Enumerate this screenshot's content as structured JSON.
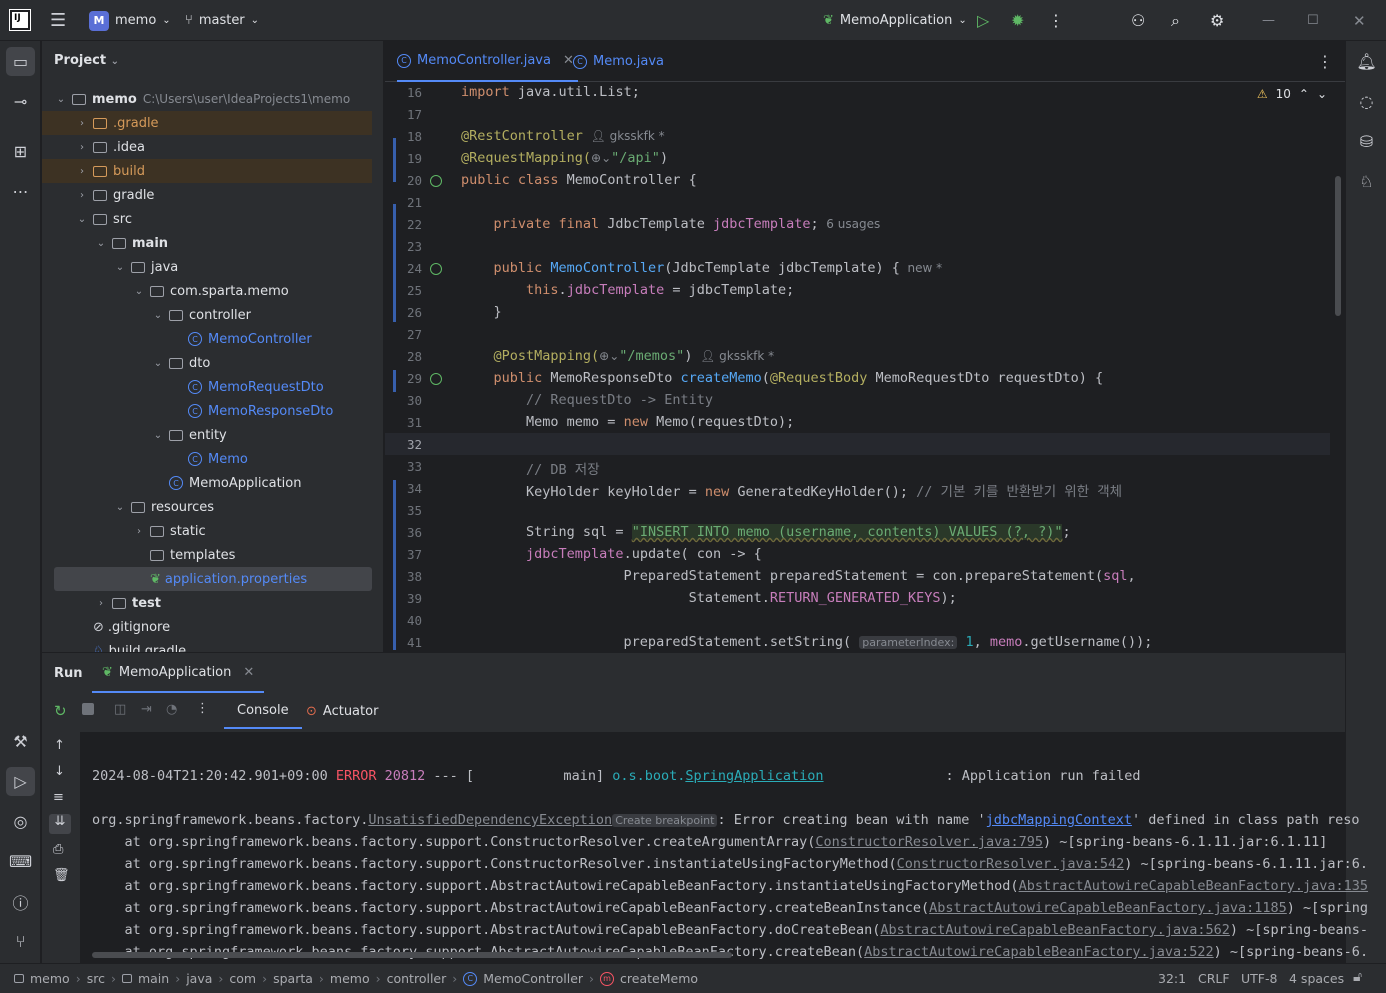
{
  "titlebar": {
    "project_badge": "M",
    "project_name": "memo",
    "branch": "master",
    "run_config": "MemoApplication"
  },
  "project_panel": {
    "title": "Project",
    "root_name": "memo",
    "root_path": "C:\\Users\\user\\IdeaProjects1\\memo",
    "items": [
      {
        "label": ".gradle",
        "kind": "folder-orange"
      },
      {
        "label": ".idea",
        "kind": "folder"
      },
      {
        "label": "build",
        "kind": "folder-orange"
      },
      {
        "label": "gradle",
        "kind": "folder"
      },
      {
        "label": "src",
        "kind": "folder"
      },
      {
        "label": "main",
        "kind": "folder"
      },
      {
        "label": "java",
        "kind": "folder"
      },
      {
        "label": "com.sparta.memo",
        "kind": "package"
      },
      {
        "label": "controller",
        "kind": "package"
      },
      {
        "label": "MemoController",
        "kind": "class"
      },
      {
        "label": "dto",
        "kind": "package"
      },
      {
        "label": "MemoRequestDto",
        "kind": "class"
      },
      {
        "label": "MemoResponseDto",
        "kind": "class"
      },
      {
        "label": "entity",
        "kind": "package"
      },
      {
        "label": "Memo",
        "kind": "class"
      },
      {
        "label": "MemoApplication",
        "kind": "app-class"
      },
      {
        "label": "resources",
        "kind": "folder"
      },
      {
        "label": "static",
        "kind": "folder"
      },
      {
        "label": "templates",
        "kind": "folder"
      },
      {
        "label": "application.properties",
        "kind": "properties"
      },
      {
        "label": "test",
        "kind": "folder"
      },
      {
        "label": ".gitignore",
        "kind": "ignore"
      },
      {
        "label": "build.gradle",
        "kind": "gradle"
      }
    ]
  },
  "editor": {
    "tabs": [
      {
        "label": "MemoController.java"
      },
      {
        "label": "Memo.java"
      }
    ],
    "warning_count": "10",
    "line_numbers": [
      "16",
      "17",
      "18",
      "19",
      "20",
      "21",
      "22",
      "23",
      "24",
      "25",
      "26",
      "27",
      "28",
      "29",
      "30",
      "31",
      "32",
      "33",
      "34",
      "35",
      "36",
      "37",
      "38",
      "39",
      "40",
      "41"
    ],
    "lines": {
      "l16a": "import",
      "l16b": " java.util.List;",
      "l18a": "@RestController",
      "l18author": "gksskfk *",
      "l19a": "@RequestMapping(",
      "l19b": "\"/api\"",
      "l19c": ")",
      "l20a": "public class",
      "l20b": " MemoController {",
      "l22a": "    private final",
      "l22b": " JdbcTemplate ",
      "l22c": "jdbcTemplate",
      "l22d": ";",
      "l22usages": "6 usages",
      "l24a": "    public",
      "l24b": " MemoController",
      "l24c": "(JdbcTemplate jdbcTemplate) {",
      "l24new": "new *",
      "l25a": "        this",
      "l25b": ".",
      "l25c": "jdbcTemplate",
      "l25d": " = jdbcTemplate;",
      "l26": "    }",
      "l28a": "    @PostMapping(",
      "l28b": "\"/memos\"",
      "l28c": ")",
      "l28author": "gksskfk *",
      "l29a": "    public",
      "l29b": " MemoResponseDto ",
      "l29c": "createMemo",
      "l29d": "(",
      "l29e": "@RequestBody",
      "l29f": " MemoRequestDto requestDto) {",
      "l30": "        // RequestDto -> Entity",
      "l31a": "        Memo memo = ",
      "l31b": "new",
      "l31c": " Memo(requestDto);",
      "l33": "        // DB 저장",
      "l34a": "        KeyHolder keyHolder = ",
      "l34b": "new",
      "l34c": " GeneratedKeyHolder(); ",
      "l34d": "// 기본 키를 반환받기 위한 객체",
      "l36a": "        String sql = ",
      "l36b": "\"INSERT INTO memo (username, contents) VALUES (?, ?)\"",
      "l36c": ";",
      "l37a": "        ",
      "l37b": "jdbcTemplate",
      "l37c": ".update( con -> {",
      "l38a": "                    PreparedStatement preparedStatement = con.prepareStatement(",
      "l38b": "sql",
      "l38c": ",",
      "l39a": "                            Statement.",
      "l39b": "RETURN_GENERATED_KEYS",
      "l39c": ");",
      "l41a": "                    preparedStatement.setString( ",
      "l41hint": "parameterIndex:",
      "l41b": " 1",
      "l41c": ", ",
      "l41d": "memo",
      "l41e": ".getUsername());"
    }
  },
  "run_panel": {
    "title": "Run",
    "tab": "MemoApplication",
    "subtabs": [
      "Console",
      "Actuator"
    ],
    "console": {
      "line1_ts": "2024-08-04T21:20:42.901+09:00 ",
      "line1_level": "ERROR",
      "line1_pid": " 20812",
      "line1_mid": " --- [           main] ",
      "line1_logger1": "o.s.boot.",
      "line1_logger2": "SpringApplication",
      "line1_msg": "               : Application run failed",
      "line2_a": "org.springframework.beans.factory.",
      "line2_exc": "UnsatisfiedDependencyException",
      "line2_bp": "Create breakpoint",
      "line2_b": ": Error creating bean with name '",
      "line2_bean": "jdbcMappingContext",
      "line2_c": "' defined in class path reso",
      "stack": [
        {
          "a": "    at org.springframework.beans.factory.support.ConstructorResolver.createArgumentArray(",
          "l": "ConstructorResolver.java:795",
          "b": ") ~[spring-beans-6.1.11.jar:6.1.11]"
        },
        {
          "a": "    at org.springframework.beans.factory.support.ConstructorResolver.instantiateUsingFactoryMethod(",
          "l": "ConstructorResolver.java:542",
          "b": ") ~[spring-beans-6.1.11.jar:6."
        },
        {
          "a": "    at org.springframework.beans.factory.support.AbstractAutowireCapableBeanFactory.instantiateUsingFactoryMethod(",
          "l": "AbstractAutowireCapableBeanFactory.java:135",
          "b": ""
        },
        {
          "a": "    at org.springframework.beans.factory.support.AbstractAutowireCapableBeanFactory.createBeanInstance(",
          "l": "AbstractAutowireCapableBeanFactory.java:1185",
          "b": ") ~[spring"
        },
        {
          "a": "    at org.springframework.beans.factory.support.AbstractAutowireCapableBeanFactory.doCreateBean(",
          "l": "AbstractAutowireCapableBeanFactory.java:562",
          "b": ") ~[spring-beans-"
        },
        {
          "a": "    at org.springframework.beans.factory.support.AbstractAutowireCapableBeanFactory.createBean(",
          "l": "AbstractAutowireCapableBeanFactory.java:522",
          "b": ") ~[spring-beans-6."
        }
      ]
    }
  },
  "status_bar": {
    "breadcrumb": [
      "memo",
      "src",
      "main",
      "java",
      "com",
      "sparta",
      "memo",
      "controller",
      "MemoController",
      "createMemo"
    ],
    "position": "32:1",
    "line_ending": "CRLF",
    "encoding": "UTF-8",
    "indent": "4 spaces"
  },
  "colors": {
    "accent": "#548af7",
    "error": "#f75464",
    "bg": "#1e1f22",
    "panel": "#2b2d30"
  }
}
